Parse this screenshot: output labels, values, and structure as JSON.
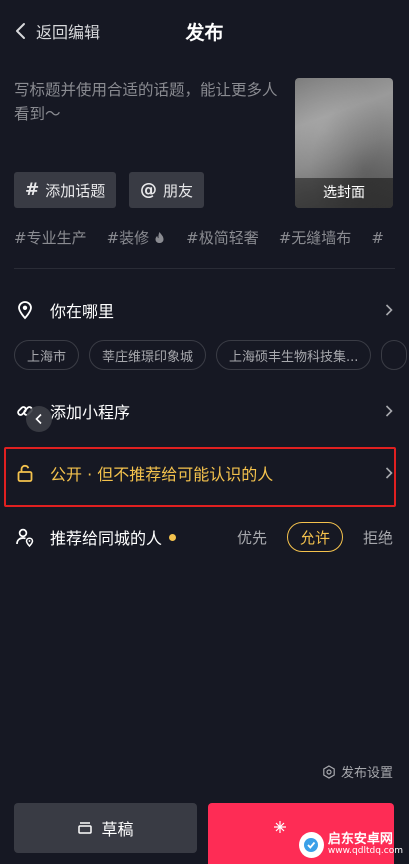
{
  "header": {
    "back_label": "返回编辑",
    "title": "发布"
  },
  "caption": {
    "placeholder": "写标题并使用合适的话题，能让更多人看到～"
  },
  "cover": {
    "label": "选封面"
  },
  "chips": {
    "topic_symbol": "#",
    "topic_label": "添加话题",
    "friend_symbol": "@",
    "friend_label": "朋友"
  },
  "hashtags": [
    "#专业生产",
    "#装修",
    "#极简轻奢",
    "#无缝墙布",
    "#"
  ],
  "location": {
    "label": "你在哪里",
    "suggestions": [
      "上海市",
      "莘庄维璟印象城",
      "上海硕丰生物科技集...",
      ""
    ]
  },
  "mini_program": {
    "label": "添加小程序"
  },
  "privacy": {
    "label": "公开 · 但不推荐给可能认识的人"
  },
  "recommend_city": {
    "label": "推荐给同城的人",
    "options": [
      "优先",
      "允许",
      "拒绝"
    ],
    "selected": "允许"
  },
  "settings_link": {
    "label": "发布设置"
  },
  "footer": {
    "draft_label": "草稿"
  },
  "watermark": {
    "title": "启东安卓网",
    "url": "www.qdltdq.com"
  },
  "colors": {
    "accent": "#f4c24d",
    "publish": "#fe2c55",
    "highlight_border": "#e02020",
    "background": "#161823"
  }
}
